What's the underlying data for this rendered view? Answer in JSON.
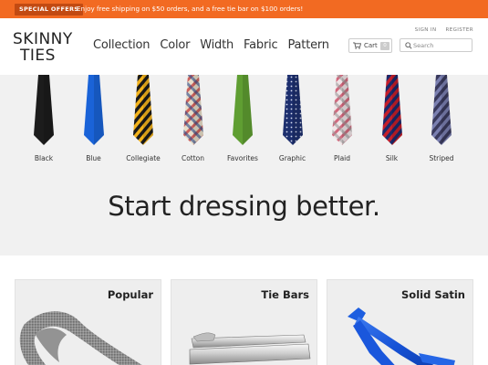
{
  "promo": {
    "badge": "SPECIAL OFFERS",
    "text": "Enjoy free shipping on $50 orders, and a free tie bar on $100 orders!"
  },
  "logo": {
    "line1": "SKINNY",
    "line2": "TIES"
  },
  "nav": [
    "Collection",
    "Color",
    "Width",
    "Fabric",
    "Pattern"
  ],
  "account": {
    "sign_in": "SIGN IN",
    "register": "REGISTER"
  },
  "cart": {
    "label": "Cart",
    "count": "0"
  },
  "search": {
    "placeholder": "Search",
    "value": ""
  },
  "ties": [
    {
      "label": "Black",
      "pattern": "solid",
      "colors": [
        "#1c1c1c"
      ]
    },
    {
      "label": "Blue",
      "pattern": "solid",
      "colors": [
        "#1a63d8"
      ]
    },
    {
      "label": "Collegiate",
      "pattern": "stripe",
      "colors": [
        "#f2b21c",
        "#1a1a1a"
      ]
    },
    {
      "label": "Cotton",
      "pattern": "plaid",
      "colors": [
        "#e8ddc8",
        "#c23a3a",
        "#2b4a8a"
      ]
    },
    {
      "label": "Favorites",
      "pattern": "solid",
      "colors": [
        "#5f9e32"
      ]
    },
    {
      "label": "Graphic",
      "pattern": "dots",
      "colors": [
        "#1d2f6e",
        "#d6dcef"
      ]
    },
    {
      "label": "Plaid",
      "pattern": "plaid",
      "colors": [
        "#f0e4e6",
        "#c8405a",
        "#9b9b9b"
      ]
    },
    {
      "label": "Silk",
      "pattern": "stripe",
      "colors": [
        "#c41e2a",
        "#1b2a6b"
      ]
    },
    {
      "label": "Striped",
      "pattern": "stripe",
      "colors": [
        "#7a7fb0",
        "#3a3a5c"
      ]
    }
  ],
  "headline": "Start dressing better.",
  "cards": [
    {
      "title": "Popular",
      "image": "gray-knit-tie-image"
    },
    {
      "title": "Tie Bars",
      "image": "silver-tie-bar-image"
    },
    {
      "title": "Solid Satin",
      "image": "blue-satin-tie-image"
    }
  ],
  "colors": {
    "promo_bg": "#f26a22",
    "promo_badge_bg": "#c24a12",
    "band_bg": "#f1f1f1",
    "card_bg": "#eeeeee"
  }
}
